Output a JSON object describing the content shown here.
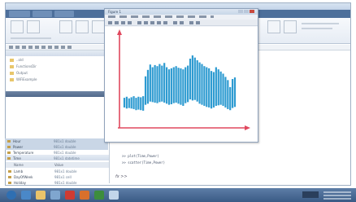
{
  "figure": {
    "title": "Figure 1",
    "chart_data": {
      "type": "bar",
      "title": "",
      "xlabel": "",
      "ylabel": "",
      "ylim": [
        0,
        17
      ],
      "categories": [
        1,
        2,
        3,
        4,
        5,
        6,
        7,
        8,
        9,
        10,
        11,
        12,
        13,
        14,
        15,
        16,
        17,
        18,
        19,
        20,
        21,
        22,
        23,
        24,
        25,
        26,
        27,
        28,
        29,
        30,
        31,
        32,
        33,
        34,
        35,
        36,
        37,
        38,
        39,
        40,
        41,
        42,
        43,
        44,
        45,
        46,
        47,
        48
      ],
      "low": [
        3.5,
        3.3,
        3.4,
        3.3,
        3.2,
        3.0,
        3.1,
        3.0,
        2.9,
        4.0,
        4.2,
        4.6,
        4.5,
        4.4,
        4.3,
        4.5,
        4.6,
        4.4,
        4.2,
        4.0,
        4.1,
        4.3,
        4.4,
        4.2,
        4.0,
        3.8,
        4.3,
        4.5,
        5.0,
        4.8,
        4.9,
        4.6,
        4.2,
        4.0,
        3.8,
        3.6,
        3.5,
        3.3,
        3.5,
        3.8,
        3.9,
        4.0,
        3.8,
        3.5,
        3.2,
        3.0,
        3.4,
        3.6
      ],
      "high": [
        5.3,
        5.5,
        5.2,
        5.4,
        5.6,
        5.3,
        5.5,
        5.4,
        5.6,
        9.3,
        10.5,
        11.5,
        11.0,
        11.4,
        11.2,
        11.6,
        11.3,
        11.8,
        11.0,
        10.6,
        10.8,
        11.0,
        11.2,
        10.9,
        10.8,
        10.6,
        11.0,
        11.3,
        12.6,
        13.2,
        12.8,
        12.3,
        11.9,
        11.6,
        11.2,
        11.0,
        10.8,
        10.3,
        10.1,
        11.0,
        10.6,
        10.2,
        9.8,
        9.2,
        8.6,
        7.3,
        8.8,
        9.1
      ],
      "colors": {
        "bars": "#2e9bd1",
        "axes": "#e0485e"
      }
    }
  },
  "command": {
    "lines": [
      ">> plot(Time,Power)",
      ">> scatter(Time,Power)"
    ],
    "prompt": "fx >>"
  },
  "workspace": {
    "headers": [
      "Name",
      "Value"
    ],
    "rows": [
      {
        "name": "Lamb",
        "value": "981x1 double"
      },
      {
        "name": "DayOfWeek",
        "value": "981x1 cell"
      },
      {
        "name": "Holiday",
        "value": "981x1 double"
      },
      {
        "name": "Hour",
        "value": "981x1 double"
      },
      {
        "name": "Power",
        "value": "981x1 double"
      },
      {
        "name": "Temperature",
        "value": "981x1 double"
      },
      {
        "name": "Time",
        "value": "981x1 datetime"
      }
    ]
  },
  "folders": {
    "items": [
      "..old",
      "FunctionsDir",
      "Output",
      "WiFiExample"
    ]
  }
}
